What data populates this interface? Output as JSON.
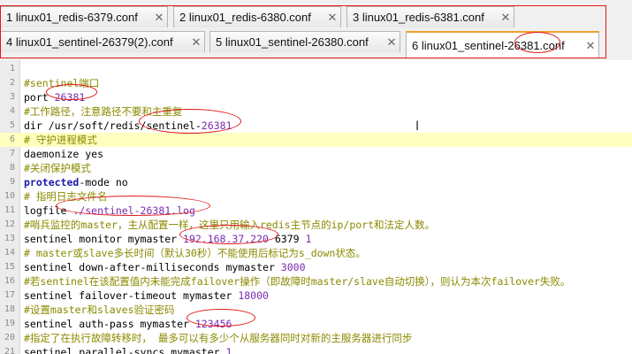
{
  "tabs": [
    {
      "label": "1 linux01_redis-6379.conf",
      "close": "✕"
    },
    {
      "label": "2 linux01_redis-6380.conf",
      "close": "✕"
    },
    {
      "label": "3 linux01_redis-6381.conf",
      "close": "✕"
    },
    {
      "label": "4 linux01_sentinel-26379(2).conf",
      "close": "✕"
    },
    {
      "label": "5 linux01_sentinel-26380.conf",
      "close": "✕"
    },
    {
      "label": "6 linux01_sentinel-26381.conf",
      "close": "✕"
    }
  ],
  "lines": [
    {
      "n": "1",
      "segs": []
    },
    {
      "n": "2",
      "segs": [
        {
          "t": "#sentinel端口",
          "c": "comment"
        }
      ]
    },
    {
      "n": "3",
      "segs": [
        {
          "t": "port ",
          "c": "plain"
        },
        {
          "t": "26381",
          "c": "num"
        }
      ]
    },
    {
      "n": "4",
      "segs": [
        {
          "t": "#工作路径，注意路径不要和主重复",
          "c": "comment"
        }
      ]
    },
    {
      "n": "5",
      "segs": [
        {
          "t": "dir /usr/soft/redis/sentinel-",
          "c": "plain"
        },
        {
          "t": "26381",
          "c": "num"
        }
      ]
    },
    {
      "n": "6",
      "segs": [
        {
          "t": "# 守护进程模式",
          "c": "comment"
        }
      ]
    },
    {
      "n": "7",
      "segs": [
        {
          "t": "daemonize yes",
          "c": "plain"
        }
      ]
    },
    {
      "n": "8",
      "segs": [
        {
          "t": "#关闭保护模式",
          "c": "comment"
        }
      ]
    },
    {
      "n": "9",
      "segs": [
        {
          "t": "protected",
          "c": "key"
        },
        {
          "t": "-mode no",
          "c": "plain"
        }
      ]
    },
    {
      "n": "10",
      "segs": [
        {
          "t": "# 指明日志文件名",
          "c": "comment"
        }
      ]
    },
    {
      "n": "11",
      "segs": [
        {
          "t": "logfile ",
          "c": "plain"
        },
        {
          "t": "./sentinel-26381.log",
          "c": "num"
        }
      ]
    },
    {
      "n": "12",
      "segs": [
        {
          "t": "#哨兵监控的master，主从配置一样，这里只用输入redis主节点的ip/port和法定人数。",
          "c": "comment"
        }
      ]
    },
    {
      "n": "13",
      "segs": [
        {
          "t": "sentinel monitor mymaster ",
          "c": "plain"
        },
        {
          "t": "192.168.37.220",
          "c": "num"
        },
        {
          "t": " 6379 ",
          "c": "plain"
        },
        {
          "t": "1",
          "c": "num"
        }
      ]
    },
    {
      "n": "14",
      "segs": [
        {
          "t": "# master或slave多长时间（默认30秒）不能使用后标记为s_down状态。",
          "c": "comment"
        }
      ]
    },
    {
      "n": "15",
      "segs": [
        {
          "t": "sentinel down-after-milliseconds mymaster ",
          "c": "plain"
        },
        {
          "t": "3000",
          "c": "num"
        }
      ]
    },
    {
      "n": "16",
      "segs": [
        {
          "t": "#若sentinel在该配置值内未能完成failover操作（即故障时master/slave自动切换），则认为本次failover失败。",
          "c": "comment"
        }
      ]
    },
    {
      "n": "17",
      "segs": [
        {
          "t": "sentinel failover-timeout mymaster ",
          "c": "plain"
        },
        {
          "t": "18000",
          "c": "num"
        }
      ]
    },
    {
      "n": "18",
      "segs": [
        {
          "t": "#设置master和slaves验证密码",
          "c": "comment"
        }
      ]
    },
    {
      "n": "19",
      "segs": [
        {
          "t": "sentinel auth-pass mymaster ",
          "c": "plain"
        },
        {
          "t": "123456",
          "c": "num"
        }
      ]
    },
    {
      "n": "20",
      "segs": [
        {
          "t": "#指定了在执行故障转移时， 最多可以有多少个从服务器同时对新的主服务器进行同步",
          "c": "comment"
        }
      ]
    },
    {
      "n": "21",
      "segs": [
        {
          "t": "sentinel parallel-syncs mymaster ",
          "c": "plain"
        },
        {
          "t": "1",
          "c": "num"
        }
      ]
    }
  ],
  "current_line": "6",
  "colors": {
    "comment": "#8a8a00",
    "number": "#7a2bb0",
    "keyword": "#1a1aaa",
    "annotation": "#e01818",
    "active_tab_accent": "#f0a030"
  }
}
